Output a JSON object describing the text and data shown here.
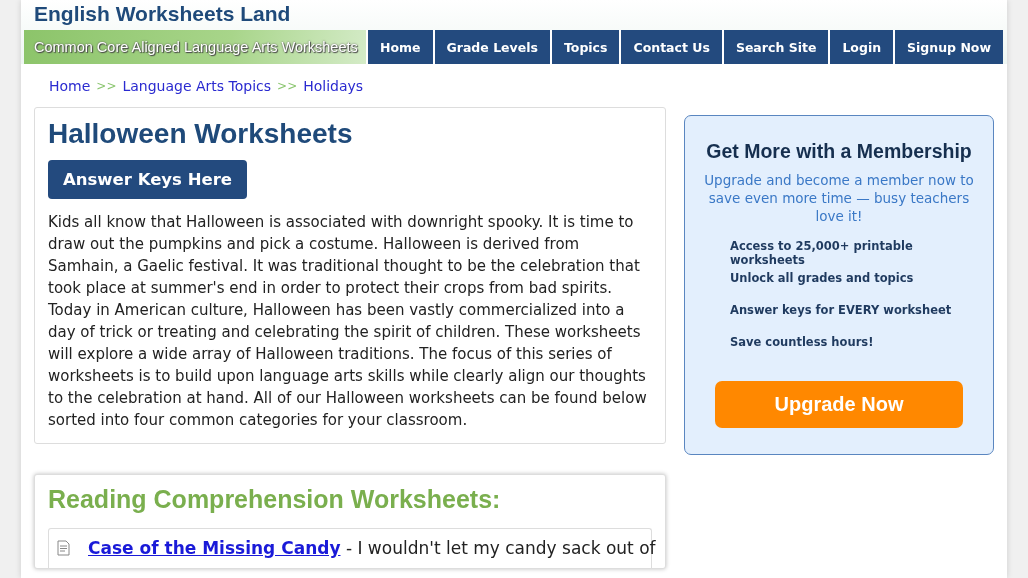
{
  "site": {
    "title": "English Worksheets Land",
    "tagline": "Common Core Aligned Language Arts Worksheets"
  },
  "nav": [
    "Home",
    "Grade Levels",
    "Topics",
    "Contact Us",
    "Search Site",
    "Login",
    "Signup Now"
  ],
  "breadcrumb": [
    "Home",
    "Language Arts Topics",
    "Holidays"
  ],
  "breadcrumb_separator": ">>",
  "intro": {
    "title": "Halloween Worksheets",
    "button": "Answer Keys Here",
    "text": "Kids all know that Halloween is associated with downright spooky. It is time to draw out the pumpkins and pick a costume. Halloween is derived from Samhain, a Gaelic festival. It was traditional thought to be the celebration that took place at summer's end in order to protect their crops from bad spirits. Today in American culture, Halloween has been vastly commercialized into a day of trick or treating and celebrating the spirit of children. These worksheets will explore a wide array of Halloween traditions. The focus of this series of worksheets is to build upon language arts skills while clearly align our thoughts to the celebration at hand. All of our Halloween worksheets can be found below sorted into four common categories for your classroom."
  },
  "section": {
    "title": "Reading Comprehension Worksheets:",
    "items": [
      {
        "link": "Case of the Missing Candy",
        "text": " - I wouldn't let my candy sack out of"
      }
    ]
  },
  "membership": {
    "title": "Get More with a Membership",
    "subtitle": "Upgrade and become a member now to save even more time — busy teachers love it!",
    "benefits": [
      "Access to 25,000+ printable worksheets",
      "Unlock all grades and topics",
      "Answer keys for EVERY worksheet",
      "Save countless hours!"
    ],
    "button": "Upgrade Now"
  }
}
